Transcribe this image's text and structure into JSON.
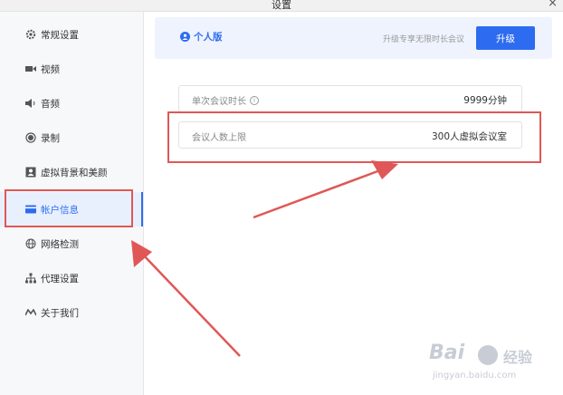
{
  "window": {
    "title": "设置",
    "close_label": "×"
  },
  "sidebar": {
    "items": [
      {
        "label": "常规设置",
        "icon": "gear-icon",
        "active": false
      },
      {
        "label": "视频",
        "icon": "video-icon",
        "active": false
      },
      {
        "label": "音频",
        "icon": "speaker-icon",
        "active": false
      },
      {
        "label": "录制",
        "icon": "record-icon",
        "active": false
      },
      {
        "label": "虚拟背景和美颜",
        "icon": "portrait-icon",
        "active": false
      },
      {
        "label": "帐户信息",
        "icon": "card-icon",
        "active": true
      },
      {
        "label": "网络检测",
        "icon": "globe-icon",
        "active": false
      },
      {
        "label": "代理设置",
        "icon": "network-icon",
        "active": false
      },
      {
        "label": "关于我们",
        "icon": "logo-icon",
        "active": false
      }
    ]
  },
  "account": {
    "plan_name": "个人版",
    "upgrade_tip": "升级专享无限时长会议",
    "upgrade_button": "升级",
    "rows": [
      {
        "label": "单次会议时长",
        "value": "9999分钟",
        "has_info": true
      },
      {
        "label": "会议人数上限",
        "value": "300人虚拟会议室",
        "has_info": false
      }
    ]
  },
  "watermark": {
    "brand": "Bai",
    "text": "经验",
    "url": "jingyan.baidu.com"
  },
  "colors": {
    "accent": "#2d6cf0",
    "annotation": "#e05757"
  }
}
